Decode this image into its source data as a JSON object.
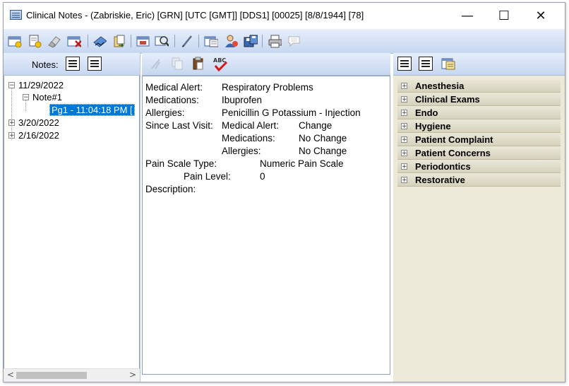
{
  "window": {
    "title": "Clinical Notes - (Zabriskie, Eric) [GRN] [UTC  [GMT]] [DDS1] [00025] [8/8/1944] [78]",
    "minimize_glyph": "—",
    "maximize_glyph": "☐",
    "close_glyph": "✕"
  },
  "toolbar": {
    "icons": [
      "new-note-icon",
      "new-page-icon",
      "eraser-icon",
      "delete-note-icon",
      "sign-icon",
      "copy-forward-icon",
      "preview-icon",
      "search-icon",
      "pen-icon",
      "template-icon",
      "provider-icon",
      "save-icon",
      "print-icon",
      "comment-icon"
    ]
  },
  "left_pane": {
    "notes_label": "Notes:",
    "tree": [
      {
        "label": "11/29/2022",
        "expander": "−"
      },
      {
        "label": "Note#1",
        "expander": "−"
      },
      {
        "label": "Pg1 - 11:04:18 PM ["
      },
      {
        "label": "3/20/2022",
        "expander": "+"
      },
      {
        "label": "2/16/2022",
        "expander": "+"
      }
    ],
    "scroll_left": "<",
    "scroll_right": ">"
  },
  "middle_pane": {
    "lines": {
      "medical_alert_label": "Medical Alert:",
      "medical_alert_value": "Respiratory Problems",
      "medications_label": "Medications:",
      "medications_value": "Ibuprofen",
      "allergies_label": "Allergies:",
      "allergies_value": "Penicillin G Potassium - Injection",
      "since_last_visit_label": "Since Last Visit:",
      "slv_medical_alert_label": "Medical Alert:",
      "slv_medical_alert_value": "Change",
      "slv_medications_label": "Medications:",
      "slv_medications_value": "No Change",
      "slv_allergies_label": "Allergies:",
      "slv_allergies_value": "No Change",
      "pain_scale_type_label": "Pain Scale Type:",
      "pain_scale_type_value": "Numeric Pain Scale",
      "pain_level_label": "Pain Level:",
      "pain_level_value": "0",
      "description_label": "Description:"
    }
  },
  "right_pane": {
    "categories": [
      "Anesthesia",
      "Clinical Exams",
      "Endo",
      "Hygiene",
      "Patient Complaint",
      "Patient Concerns",
      "Periodontics",
      "Restorative"
    ],
    "expander_glyph": "+"
  },
  "colors": {
    "toolbar_gradient_top": "#e6eefb",
    "toolbar_gradient_bottom": "#c7d7f0",
    "selection": "#0078d7",
    "category_bg": "#ece9d8"
  }
}
